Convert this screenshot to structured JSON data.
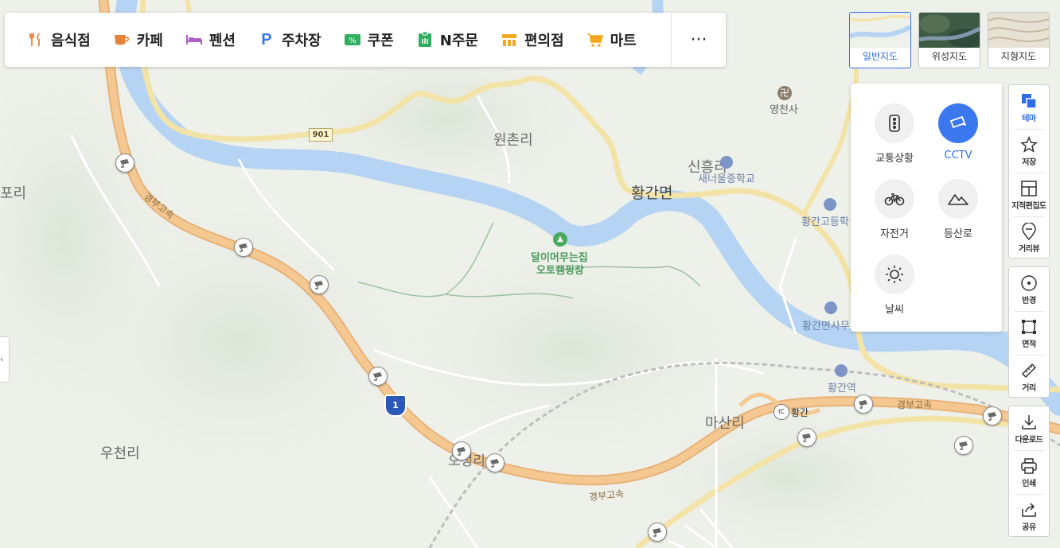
{
  "toolbar": {
    "categories": [
      {
        "label": "음식점",
        "icon": "fork-knife-icon",
        "color": "#e8833a"
      },
      {
        "label": "카페",
        "icon": "cup-icon",
        "color": "#e8833a"
      },
      {
        "label": "펜션",
        "icon": "bed-icon",
        "color": "#b05ec8"
      },
      {
        "label": "주차장",
        "icon": "parking-icon",
        "color": "#3b78f0"
      },
      {
        "label": "쿠폰",
        "icon": "coupon-icon",
        "color": "#2eae5e"
      },
      {
        "label": "N주문",
        "icon": "order-icon",
        "color": "#2eae5e"
      },
      {
        "label": "편의점",
        "icon": "store-icon",
        "color": "#f2a81e"
      },
      {
        "label": "마트",
        "icon": "cart-icon",
        "color": "#f2a81e"
      }
    ],
    "more_label": "···"
  },
  "map_types": [
    {
      "label": "일반지도",
      "active": true
    },
    {
      "label": "위성지도",
      "active": false
    },
    {
      "label": "지형지도",
      "active": false
    }
  ],
  "theme_panel": {
    "items": [
      {
        "label": "교통상황",
        "icon": "traffic-light-icon",
        "selected": false
      },
      {
        "label": "CCTV",
        "icon": "cctv-icon",
        "selected": true
      },
      {
        "label": "자전거",
        "icon": "bicycle-icon",
        "selected": false
      },
      {
        "label": "등산로",
        "icon": "mountain-icon",
        "selected": false
      },
      {
        "label": "날씨",
        "icon": "sun-icon",
        "selected": false
      }
    ]
  },
  "right_tools": {
    "group1": [
      {
        "label": "테마",
        "icon": "layers-icon",
        "active": true
      },
      {
        "label": "저장",
        "icon": "star-icon",
        "active": false
      },
      {
        "label": "지적편집도",
        "icon": "grid-map-icon",
        "active": false
      },
      {
        "label": "거리뷰",
        "icon": "pin-icon",
        "active": false
      }
    ],
    "group2": [
      {
        "label": "반경",
        "icon": "radius-icon",
        "active": false
      },
      {
        "label": "면적",
        "icon": "area-icon",
        "active": false
      },
      {
        "label": "거리",
        "icon": "ruler-icon",
        "active": false
      }
    ],
    "group3": [
      {
        "label": "다운로드",
        "icon": "download-icon",
        "active": false
      },
      {
        "label": "인쇄",
        "icon": "print-icon",
        "active": false
      },
      {
        "label": "공유",
        "icon": "share-icon",
        "active": false
      }
    ]
  },
  "map_labels": {
    "wonchonri": "원촌리",
    "hwanggan_myeon": "황간면",
    "sinheung": "신흥리",
    "saeneoul_school": "새너울중학교",
    "yeongcheonsa": "영천사",
    "hwanggan_high": "황간고등학",
    "dali_camp_1": "달이머무는집",
    "dali_camp_2": "오토캠핑장",
    "hwanggan_office": "황간면사무",
    "hwanggan_station": "황간역",
    "masanri": "마산리",
    "ic_badge": "IC",
    "ic_hwanggan": "황간",
    "gyeongbu_1": "경부고속",
    "gyeongbu_2": "경부고속",
    "gyeongbu_3": "경부고속",
    "ucheonri": "우천리",
    "pori": "포리",
    "ojeongri": "오정리",
    "route_901": "901",
    "route_1": "1"
  }
}
